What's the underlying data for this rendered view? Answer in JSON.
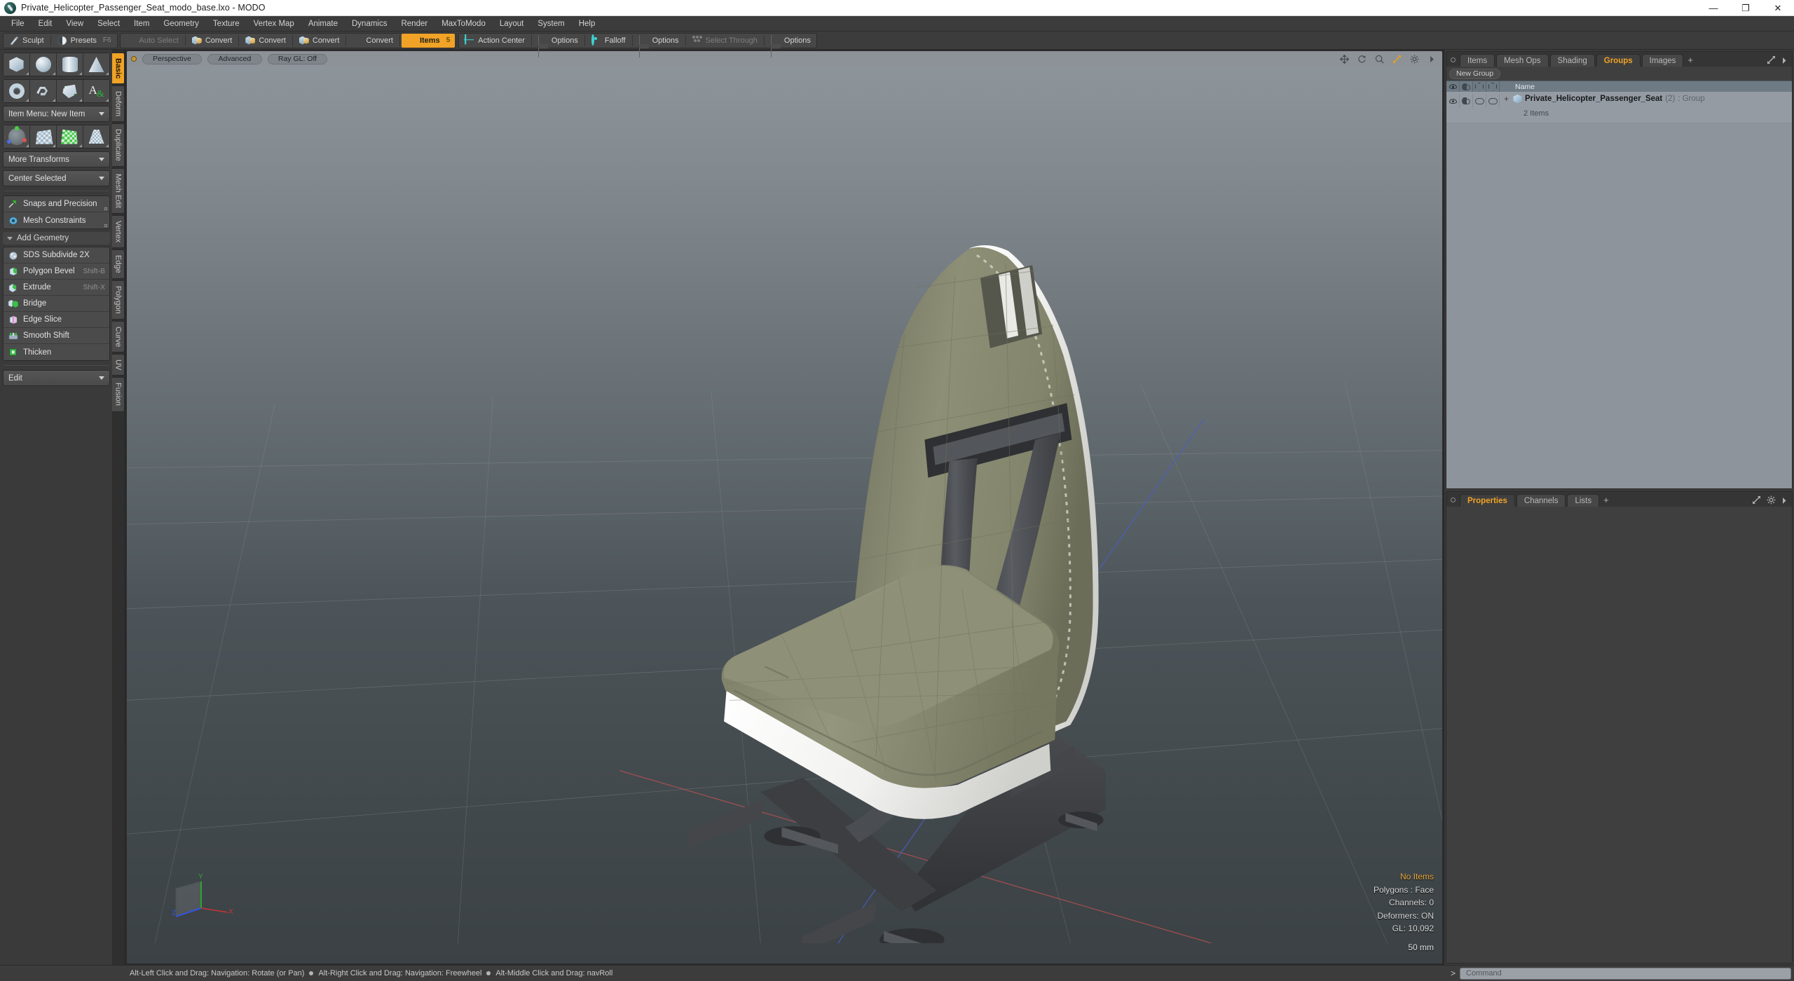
{
  "window": {
    "title": "Private_Helicopter_Passenger_Seat_modo_base.lxo - MODO",
    "app_icon": "modo-logo-icon",
    "minimize": "—",
    "maximize": "❐",
    "close": "✕"
  },
  "menubar": {
    "items": [
      {
        "label": "File"
      },
      {
        "label": "Edit"
      },
      {
        "label": "View"
      },
      {
        "label": "Select"
      },
      {
        "label": "Item"
      },
      {
        "label": "Geometry"
      },
      {
        "label": "Texture"
      },
      {
        "label": "Vertex Map"
      },
      {
        "label": "Animate"
      },
      {
        "label": "Dynamics"
      },
      {
        "label": "Render"
      },
      {
        "label": "MaxToModo"
      },
      {
        "label": "Layout"
      },
      {
        "label": "System"
      },
      {
        "label": "Help"
      }
    ]
  },
  "toolbar": {
    "group1": [
      {
        "label": "Sculpt",
        "icon": "sculpt-brush-icon",
        "state": "normal",
        "shortcut": ""
      },
      {
        "label": "Presets",
        "icon": "presets-sphere-icon",
        "state": "normal",
        "shortcut": "F6"
      }
    ],
    "group2": [
      {
        "label": "Auto Select",
        "icon": "grey-cube-icon",
        "state": "disabled",
        "shortcut": ""
      },
      {
        "label": "Convert",
        "icon": "vertex-convert-icon",
        "state": "normal",
        "shortcut": ""
      },
      {
        "label": "Convert",
        "icon": "edge-convert-icon",
        "state": "normal",
        "shortcut": ""
      },
      {
        "label": "Convert",
        "icon": "polygon-convert-icon",
        "state": "normal",
        "shortcut": ""
      },
      {
        "label": "Convert",
        "icon": "material-convert-icon",
        "state": "normal",
        "shortcut": ""
      },
      {
        "label": "Items",
        "icon": "items-cube-icon",
        "state": "active",
        "shortcut": "5"
      }
    ],
    "group3": [
      {
        "label": "Action Center",
        "icon": "action-center-icon",
        "state": "normal"
      },
      {
        "label": "Options",
        "icon": "options-icon",
        "state": "normal"
      },
      {
        "label": "Falloff",
        "icon": "falloff-icon",
        "state": "normal"
      },
      {
        "label": "Options",
        "icon": "options-icon",
        "state": "normal"
      },
      {
        "label": "Select Through",
        "icon": "select-through-icon",
        "state": "disabled"
      },
      {
        "label": "Options",
        "icon": "options-icon",
        "state": "normal"
      }
    ]
  },
  "left_panel": {
    "primitives_row1": [
      {
        "name": "cube-primitive",
        "shape": "box"
      },
      {
        "name": "sphere-primitive",
        "shape": "sphere"
      },
      {
        "name": "cylinder-primitive",
        "shape": "cylinder"
      },
      {
        "name": "cone-primitive",
        "shape": "cone"
      }
    ],
    "primitives_row2": [
      {
        "name": "torus-primitive",
        "shape": "torus"
      },
      {
        "name": "spiral-primitive",
        "shape": "spiral"
      },
      {
        "name": "polygon-tool",
        "shape": "polygon"
      },
      {
        "name": "text-tool",
        "shape": "text"
      }
    ],
    "item_menu": "Item Menu: New Item",
    "transform_row": [
      {
        "name": "transform-gizmo-tool",
        "shape": "axis"
      },
      {
        "name": "uv-checker-tool",
        "shape": "checker"
      },
      {
        "name": "green-checker-tool",
        "shape": "checker-green"
      },
      {
        "name": "falloff-grid-tool",
        "shape": "falloff-grid"
      }
    ],
    "more_transforms": "More Transforms",
    "center_selected": "Center Selected",
    "snaps": {
      "label": "Snaps and Precision",
      "icon": "snap-magnet-icon"
    },
    "constraints": {
      "label": "Mesh Constraints",
      "icon": "mesh-constraint-icon"
    },
    "add_geometry_header": "Add Geometry",
    "geometry_tools": [
      {
        "label": "SDS Subdivide 2X",
        "shortcut": "",
        "icon": "sds-subdivide-icon"
      },
      {
        "label": "Polygon Bevel",
        "shortcut": "Shift-B",
        "icon": "polygon-bevel-icon"
      },
      {
        "label": "Extrude",
        "shortcut": "Shift-X",
        "icon": "extrude-icon"
      },
      {
        "label": "Bridge",
        "shortcut": "",
        "icon": "bridge-icon"
      },
      {
        "label": "Edge Slice",
        "shortcut": "",
        "icon": "edge-slice-icon"
      },
      {
        "label": "Smooth Shift",
        "shortcut": "",
        "icon": "smooth-shift-icon"
      },
      {
        "label": "Thicken",
        "shortcut": "",
        "icon": "thicken-icon"
      }
    ],
    "edit_dropdown": "Edit",
    "vertical_tabs": [
      {
        "label": "Basic",
        "active": true
      },
      {
        "label": "Deform",
        "active": false
      },
      {
        "label": "Duplicate",
        "active": false
      },
      {
        "label": "Mesh Edit",
        "active": false
      },
      {
        "label": "Vertex",
        "active": false
      },
      {
        "label": "Edge",
        "active": false
      },
      {
        "label": "Polygon",
        "active": false
      },
      {
        "label": "Curve",
        "active": false
      },
      {
        "label": "UV",
        "active": false
      },
      {
        "label": "Fusion",
        "active": false
      }
    ]
  },
  "viewport": {
    "header_pills": [
      {
        "label": "Perspective",
        "name": "viewport-view-mode"
      },
      {
        "label": "Advanced",
        "name": "viewport-shading-mode"
      },
      {
        "label": "Ray GL: Off",
        "name": "viewport-raygl-toggle"
      }
    ],
    "header_icons": [
      {
        "name": "move-viewport-icon"
      },
      {
        "name": "rotate-viewport-icon"
      },
      {
        "name": "zoom-viewport-icon"
      },
      {
        "name": "fit-viewport-icon"
      },
      {
        "name": "viewport-settings-gear-icon"
      },
      {
        "name": "viewport-menu-arrow-icon"
      }
    ],
    "axis_gizmo": {
      "x": "X",
      "y": "Y",
      "z": "Z"
    },
    "stats": {
      "selection": "No Items",
      "polygons": "Polygons : Face",
      "channels": "Channels: 0",
      "deformers": "Deformers: ON",
      "gl": "GL: 10,092",
      "grid_size": "50 mm"
    }
  },
  "right_panel": {
    "top_tabs": [
      {
        "label": "Items",
        "active": false
      },
      {
        "label": "Mesh Ops",
        "active": false
      },
      {
        "label": "Shading",
        "active": false
      },
      {
        "label": "Groups",
        "active": true
      },
      {
        "label": "Images",
        "active": false
      }
    ],
    "add_tab": "+",
    "new_group_button": "New Group",
    "columns": [
      {
        "name": "visibility-column",
        "icon": "eye-icon"
      },
      {
        "name": "shading-column",
        "icon": "shade-icon"
      },
      {
        "name": "render-column",
        "icon": "render-cube-icon"
      },
      {
        "name": "lock-column",
        "icon": "lock-cube-icon"
      },
      {
        "name": "name-column",
        "label": "Name"
      }
    ],
    "name_header": "Name",
    "rows": [
      {
        "expander": "+",
        "icon": "group-item-icon",
        "name": "Private_Helicopter_Passenger_Seat",
        "count": "(2)",
        "type": ": Group",
        "subtitle": "2 Items"
      }
    ],
    "bottom_tabs": [
      {
        "label": "Properties",
        "active": true
      },
      {
        "label": "Channels",
        "active": false
      },
      {
        "label": "Lists",
        "active": false
      }
    ],
    "bottom_add_tab": "+"
  },
  "statusbar": {
    "hints": [
      "Alt-Left Click and Drag: Navigation: Rotate (or Pan)",
      "Alt-Right Click and Drag: Navigation: Freewheel",
      "Alt-Middle Click and Drag: navRoll"
    ],
    "command_prompt": ">",
    "command_placeholder": "Command"
  },
  "colors": {
    "accent": "#f0a326",
    "panel": "#3c3c3c",
    "viewport_top": "#8d949a",
    "viewport_bottom": "#3b4145",
    "seat_fabric": "#8a8a72",
    "seat_trim": "#ededea",
    "harness": "#4c4e52"
  }
}
